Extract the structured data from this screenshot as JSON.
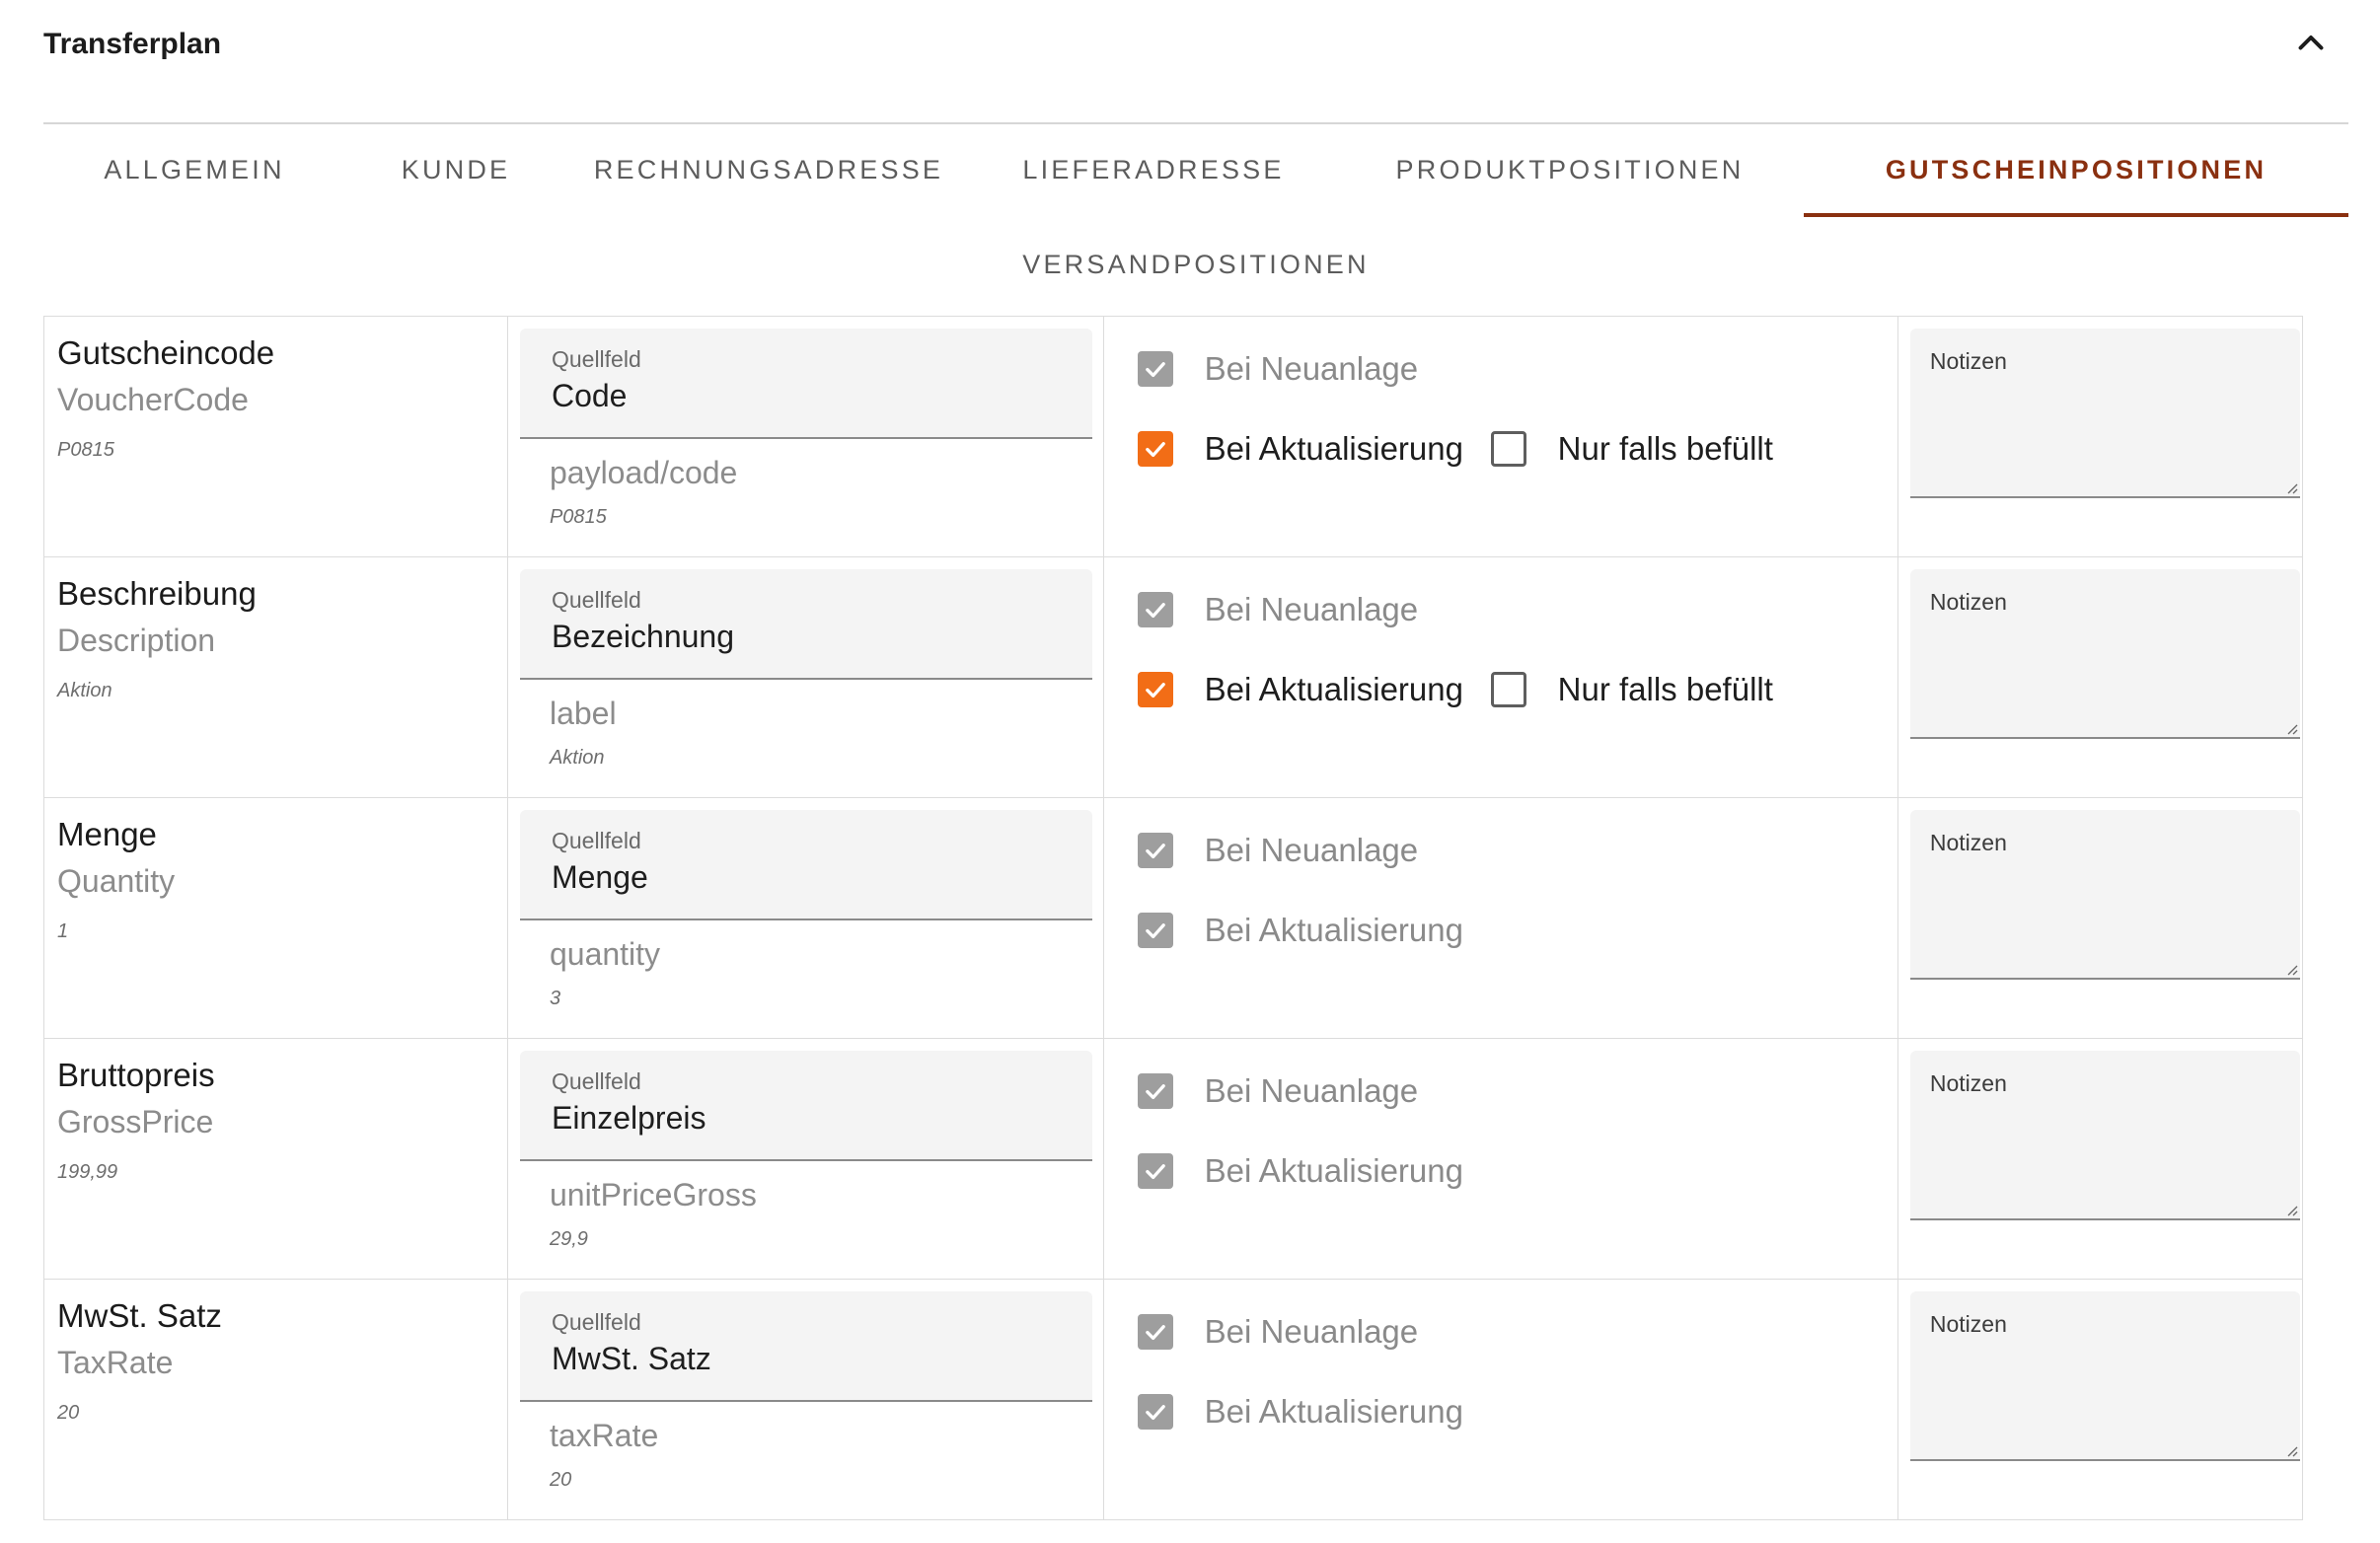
{
  "panel": {
    "title": "Transferplan",
    "collapse_icon": "chevron-up-icon"
  },
  "tabs": [
    {
      "label": "ALLGEMEIN",
      "active": false
    },
    {
      "label": "KUNDE",
      "active": false
    },
    {
      "label": "RECHNUNGSADRESSE",
      "active": false
    },
    {
      "label": "LIEFERADRESSE",
      "active": false
    },
    {
      "label": "PRODUKTPOSITIONEN",
      "active": false
    },
    {
      "label": "GUTSCHEINPOSITIONEN",
      "active": true
    },
    {
      "label": "VERSANDPOSITIONEN",
      "active": false
    }
  ],
  "colors": {
    "accent": "#8a3010",
    "checkbox_orange": "#f26d16",
    "checkbox_disabled": "#9e9e9e"
  },
  "labels": {
    "source_field": "Quellfeld",
    "on_create": "Bei Neuanlage",
    "on_update": "Bei Aktualisierung",
    "only_if_filled": "Nur falls befüllt",
    "notes": "Notizen"
  },
  "rows": [
    {
      "target_label": "Gutscheincode",
      "target_key": "VoucherCode",
      "target_sample": "P0815",
      "source_value": "Code",
      "source_path": "payload/code",
      "source_sample": "P0815",
      "on_create": "checked-disabled",
      "on_update": "checked",
      "only_if_filled": "unchecked"
    },
    {
      "target_label": "Beschreibung",
      "target_key": "Description",
      "target_sample": "Aktion",
      "source_value": "Bezeichnung",
      "source_path": "label",
      "source_sample": "Aktion",
      "on_create": "checked-disabled",
      "on_update": "checked",
      "only_if_filled": "unchecked"
    },
    {
      "target_label": "Menge",
      "target_key": "Quantity",
      "target_sample": "1",
      "source_value": "Menge",
      "source_path": "quantity",
      "source_sample": "3",
      "on_create": "checked-disabled",
      "on_update": "checked-disabled"
    },
    {
      "target_label": "Bruttopreis",
      "target_key": "GrossPrice",
      "target_sample": "199,99",
      "source_value": "Einzelpreis",
      "source_path": "unitPriceGross",
      "source_sample": "29,9",
      "on_create": "checked-disabled",
      "on_update": "checked-disabled"
    },
    {
      "target_label": "MwSt. Satz",
      "target_key": "TaxRate",
      "target_sample": "20",
      "source_value": "MwSt. Satz",
      "source_path": "taxRate",
      "source_sample": "20",
      "on_create": "checked-disabled",
      "on_update": "checked-disabled"
    }
  ]
}
